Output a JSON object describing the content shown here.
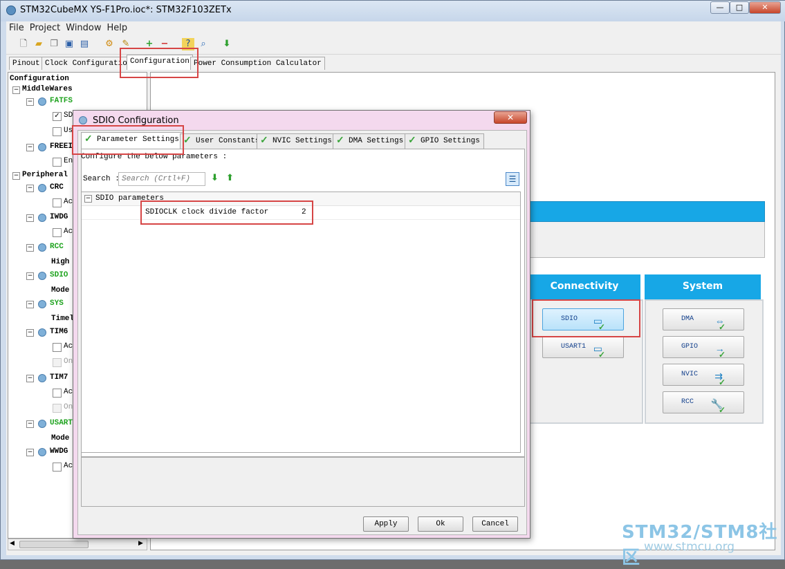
{
  "window": {
    "title": "STM32CubeMX YS-F1Pro.ioc*: STM32F103ZETx",
    "minimize": "—",
    "maximize": "□",
    "close": "✕"
  },
  "menu": [
    "File",
    "Project",
    "Window",
    "Help"
  ],
  "main_tabs": [
    "Pinout",
    "Clock Configuration",
    "Configuration",
    "Power Consumption Calculator"
  ],
  "tree": {
    "root": "Configuration",
    "middlewares": "MiddleWares",
    "fatfs": "FATFS",
    "fatfs_sd": "SD",
    "fatfs_us": "Us",
    "freertos": "FREEI",
    "freertos_en": "En",
    "peripherals": "Peripheral",
    "crc": "CRC",
    "crc_ac": "Ac",
    "iwdg": "IWDG",
    "iwdg_ac": "Ac",
    "rcc": "RCC",
    "rcc_high": "High",
    "sdio": "SDIO",
    "sdio_mode": "Mode",
    "sys": "SYS",
    "sys_time": "Timel",
    "tim6": "TIM6",
    "tim6_ac": "Ac",
    "tim6_on": "On",
    "tim7": "TIM7",
    "tim7_ac": "Ac",
    "tim7_on": "On",
    "usart": "USART",
    "usart_mode": "Mode",
    "wwdg": "WWDG",
    "wwdg_ac": "Ac"
  },
  "categories": {
    "connectivity": "Connectivity",
    "system": "System",
    "conn_buttons": [
      "SDIO",
      "USART1"
    ],
    "sys_buttons": [
      "DMA",
      "GPIO",
      "NVIC",
      "RCC"
    ]
  },
  "dialog": {
    "title": "SDIO Configuration",
    "close": "✕",
    "tabs": [
      "Parameter Settings",
      "User Constants",
      "NVIC Settings",
      "DMA Settings",
      "GPIO Settings"
    ],
    "instruction": "Configure the below parameters :",
    "search_label": "Search :",
    "search_placeholder": "Search (Crtl+F)",
    "group": "SDIO parameters",
    "param_name": "SDIOCLK clock divide factor",
    "param_value": "2",
    "apply": "Apply",
    "ok": "Ok",
    "cancel": "Cancel"
  },
  "watermark": {
    "brand": "STM32/STM8社区",
    "url": "www.stmcu.org"
  },
  "colors": {
    "category_header": "#17a7e6",
    "highlight": "#d64545",
    "enabled_green": "#1fa31f"
  }
}
